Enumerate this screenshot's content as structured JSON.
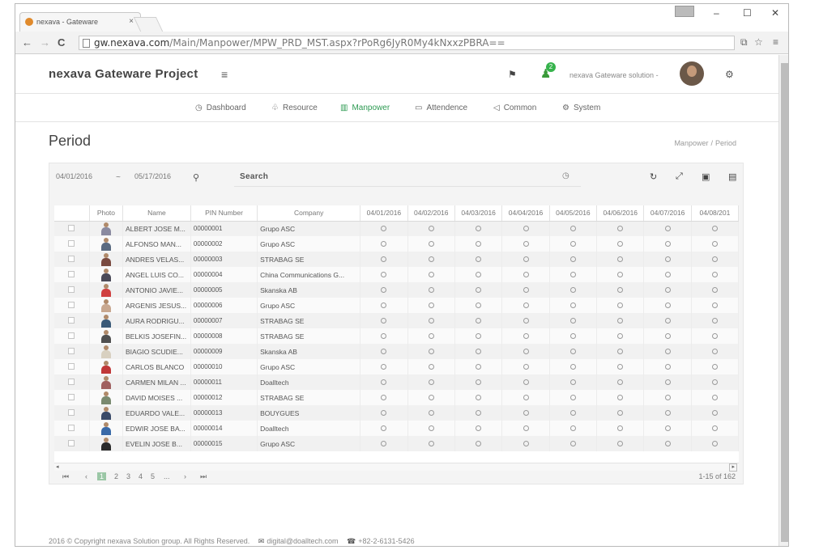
{
  "browser": {
    "tab_title": "nexava - Gateware",
    "tab_close": "×",
    "url_host": "gw.nexava.com",
    "url_path": "/Main/Manpower/MPW_PRD_MST.aspx?rPoRg6JyR0My4kNxxzPBRA=="
  },
  "app": {
    "brand": "nexava Gateware Project",
    "notification_count": "2",
    "user_label": "nexava Gateware solution -"
  },
  "menu": [
    {
      "icon": "dashboard-icon",
      "glyph": "◷",
      "label": "Dashboard",
      "active": false
    },
    {
      "icon": "resource-icon",
      "glyph": "♧",
      "label": "Resource",
      "active": false
    },
    {
      "icon": "manpower-icon",
      "glyph": "▥",
      "label": "Manpower",
      "active": true
    },
    {
      "icon": "attendence-icon",
      "glyph": "▭",
      "label": "Attendence",
      "active": false
    },
    {
      "icon": "common-icon",
      "glyph": "◁",
      "label": "Common",
      "active": false
    },
    {
      "icon": "system-icon",
      "glyph": "⚙",
      "label": "System",
      "active": false
    }
  ],
  "page": {
    "title": "Period",
    "breadcrumb": [
      "Manpower",
      "Period"
    ],
    "breadcrumb_sep": "/"
  },
  "filter": {
    "date_from": "04/01/2016",
    "date_sep": "~",
    "date_to": "05/17/2016",
    "search_label": "Search"
  },
  "table": {
    "columns": [
      "Photo",
      "Name",
      "PIN Number",
      "Company",
      "04/01/2016",
      "04/02/2016",
      "04/03/2016",
      "04/04/2016",
      "04/05/2016",
      "04/06/2016",
      "04/07/2016",
      "04/08/201"
    ],
    "rows": [
      {
        "name": "ALBERT JOSE M...",
        "pin": "00000001",
        "company": "Grupo ASC",
        "shirt": "#8a8aa0"
      },
      {
        "name": "ALFONSO MAN...",
        "pin": "00000002",
        "company": "Grupo ASC",
        "shirt": "#5a6a80"
      },
      {
        "name": "ANDRES VELAS...",
        "pin": "00000003",
        "company": "STRABAG SE",
        "shirt": "#7a4a40"
      },
      {
        "name": "ANGEL LUIS CO...",
        "pin": "00000004",
        "company": "China Communications G...",
        "shirt": "#4a4a58"
      },
      {
        "name": "ANTONIO JAVIE...",
        "pin": "00000005",
        "company": "Skanska AB",
        "shirt": "#d04040"
      },
      {
        "name": "ARGENIS JESUS...",
        "pin": "00000006",
        "company": "Grupo ASC",
        "shirt": "#c8a890"
      },
      {
        "name": "AURA RODRIGU...",
        "pin": "00000007",
        "company": "STRABAG SE",
        "shirt": "#3a5a78"
      },
      {
        "name": "BELKIS JOSEFIN...",
        "pin": "00000008",
        "company": "STRABAG SE",
        "shirt": "#505050"
      },
      {
        "name": "BIAGIO SCUDIE...",
        "pin": "00000009",
        "company": "Skanska AB",
        "shirt": "#d8d0c0"
      },
      {
        "name": "CARLOS BLANCO",
        "pin": "00000010",
        "company": "Grupo ASC",
        "shirt": "#c03838"
      },
      {
        "name": "CARMEN MILAN ...",
        "pin": "00000011",
        "company": "Doalltech",
        "shirt": "#a06060"
      },
      {
        "name": "DAVID MOISES ...",
        "pin": "00000012",
        "company": "STRABAG SE",
        "shirt": "#7a8a70"
      },
      {
        "name": "EDUARDO VALE...",
        "pin": "00000013",
        "company": "BOUYGUES",
        "shirt": "#3a4a68"
      },
      {
        "name": "EDWIR JOSE BA...",
        "pin": "00000014",
        "company": "Doalltech",
        "shirt": "#3a6aa8"
      },
      {
        "name": "EVELIN JOSE B...",
        "pin": "00000015",
        "company": "Grupo ASC",
        "shirt": "#2a2a2a"
      }
    ]
  },
  "pager": {
    "first": "⏮",
    "prev": "‹",
    "pages": [
      "1",
      "2",
      "3",
      "4",
      "5",
      "..."
    ],
    "next": "›",
    "last": "⏭",
    "info": "1-15 of 162"
  },
  "footer": {
    "copyright": "2016 © Copyright nexava Solution group. All Rights Reserved.",
    "email": "digital@doalltech.com",
    "phone": "+82-2-6131-5426"
  }
}
